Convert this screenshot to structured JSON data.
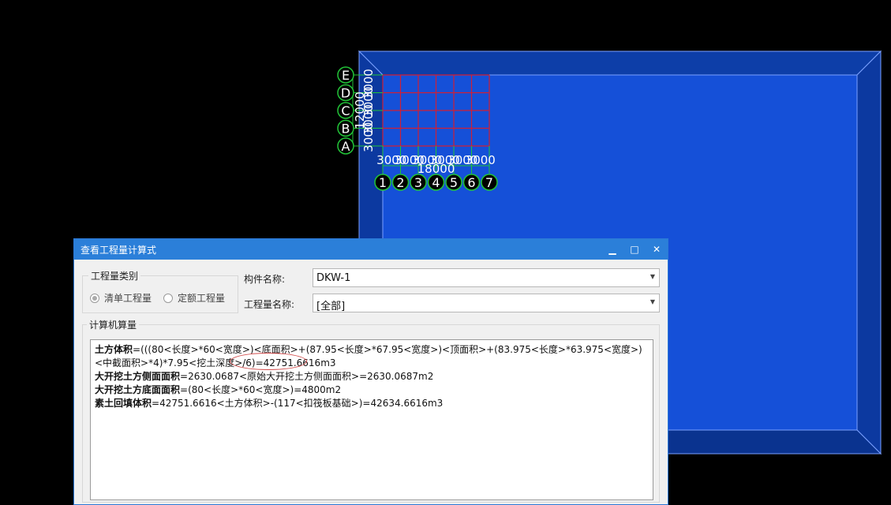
{
  "viewport": {
    "axis_rows": [
      "E",
      "D",
      "C",
      "B",
      "A"
    ],
    "axis_cols": [
      "1",
      "2",
      "3",
      "4",
      "5",
      "6",
      "7"
    ],
    "row_dim_labels": [
      "3000",
      "3000",
      "3000",
      "3000"
    ],
    "row_total_label": "12000",
    "col_dim_labels": [
      "3000",
      "3000",
      "3000",
      "3000",
      "3000",
      "3000"
    ],
    "col_total_label": "18000",
    "colors": {
      "pit_face": "#1550d8",
      "pit_wall": "#0d3ea8",
      "pit_edge": "#7aa0ff",
      "grid_line": "#d01f35",
      "axis_circle": "#22c438"
    }
  },
  "dialog": {
    "title": "查看工程量计算式",
    "min_icon": "▁",
    "max_icon": "□",
    "close_icon": "✕",
    "type_group": {
      "title": "工程量类别",
      "options": [
        {
          "label": "清单工程量",
          "selected": true
        },
        {
          "label": "定额工程量",
          "selected": false
        }
      ]
    },
    "component_name": {
      "label": "构件名称:",
      "value": "DKW-1"
    },
    "quantity_name": {
      "label": "工程量名称:",
      "value": "[全部]"
    },
    "calc_group_title": "计算机算量",
    "lines": [
      {
        "name": "土方体积",
        "expr": "=(((80<长度>*60<宽度>)<底面积>+(87.95<长度>*67.95<宽度>)<顶面积>+(83.975<长度>*63.975<宽度>)<中截面积>*4)*7.95<挖土深度>/6)=42751.6616m3"
      },
      {
        "name": "大开挖土方侧面面积",
        "expr": "=2630.0687<原始大开挖土方侧面面积>=2630.0687m2"
      },
      {
        "name": "大开挖土方底面面积",
        "expr": "=(80<长度>*60<宽度>)=4800m2"
      },
      {
        "name": "素土回填体积",
        "expr": "=42751.6616<土方体积>-(117<扣筏板基础>)=42634.6616m3"
      }
    ]
  }
}
